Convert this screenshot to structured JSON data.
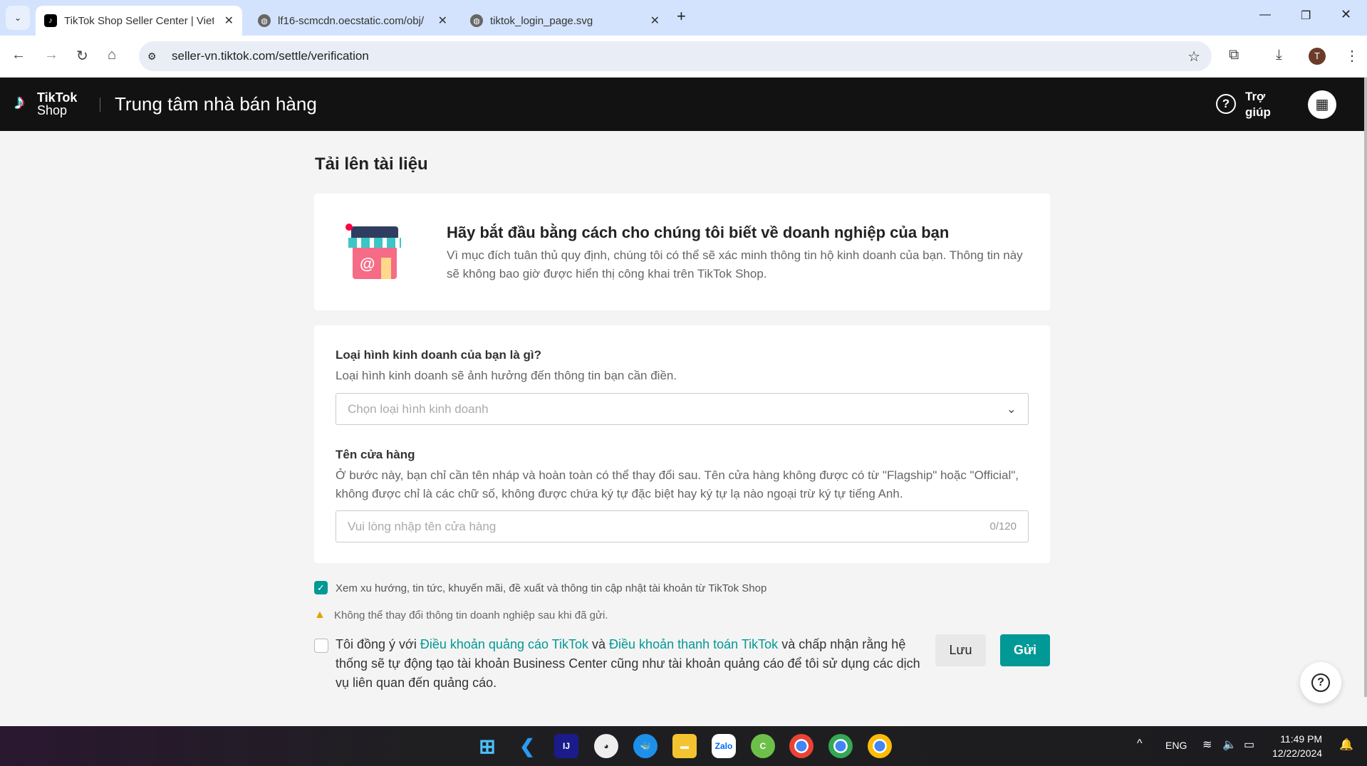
{
  "browser": {
    "tabs": [
      {
        "title": "TikTok Shop Seller Center | Vietnam"
      },
      {
        "title": "lf16-scmcdn.oecstatic.com/obj/"
      },
      {
        "title": "tiktok_login_page.svg"
      }
    ],
    "url": "seller-vn.tiktok.com/settle/verification",
    "profile": "T"
  },
  "header": {
    "logo_top": "TikTok",
    "logo_bottom": "Shop",
    "title": "Trung tâm nhà bán hàng",
    "help_line1": "Trợ",
    "help_line2": "giúp"
  },
  "page": {
    "title": "Tải lên tài liệu",
    "intro": {
      "heading": "Hãy bắt đầu bằng cách cho chúng tôi biết về doanh nghiệp của bạn",
      "text": "Vì mục đích tuân thủ quy định, chúng tôi có thể sẽ xác minh thông tin hộ kinh doanh của bạn. Thông tin này sẽ không bao giờ được hiển thị công khai trên TikTok Shop."
    },
    "business_type": {
      "label": "Loại hình kinh doanh của bạn là gì?",
      "hint": "Loại hình kinh doanh sẽ ảnh hưởng đến thông tin bạn cần điền.",
      "placeholder": "Chọn loại hình kinh doanh"
    },
    "shop_name": {
      "label": "Tên cửa hàng",
      "hint": "Ở bước này, bạn chỉ cần tên nháp và hoàn toàn có thể thay đổi sau. Tên cửa hàng không được có từ \"Flagship\" hoặc \"Official\", không được chỉ là các chữ số, không được chứa ký tự đặc biệt hay ký tự lạ nào ngoại trừ ký tự tiếng Anh.",
      "placeholder": "Vui lòng nhập tên cửa hàng",
      "counter": "0/120"
    },
    "newsletter": "Xem xu hướng, tin tức, khuyến mãi, đề xuất và thông tin cập nhật tài khoản từ TikTok Shop",
    "warning": "Không thể thay đổi thông tin doanh nghiệp sau khi đã gửi.",
    "terms": {
      "pre": "Tôi đồng ý với ",
      "link1": "Điều khoản quảng cáo TikTok",
      "mid": " và ",
      "link2": "Điều khoản thanh toán TikTok",
      "post": " và chấp nhận rằng hệ thống sẽ tự động tạo tài khoản Business Center cũng như tài khoản quảng cáo để tôi sử dụng các dịch vụ liên quan đến quảng cáo."
    },
    "save": "Lưu",
    "submit": "Gửi"
  },
  "taskbar": {
    "lang": "ENG",
    "time": "11:49 PM",
    "date": "12/22/2024",
    "apps": [
      "Zalo"
    ]
  },
  "colors": {
    "accent": "#009995"
  }
}
